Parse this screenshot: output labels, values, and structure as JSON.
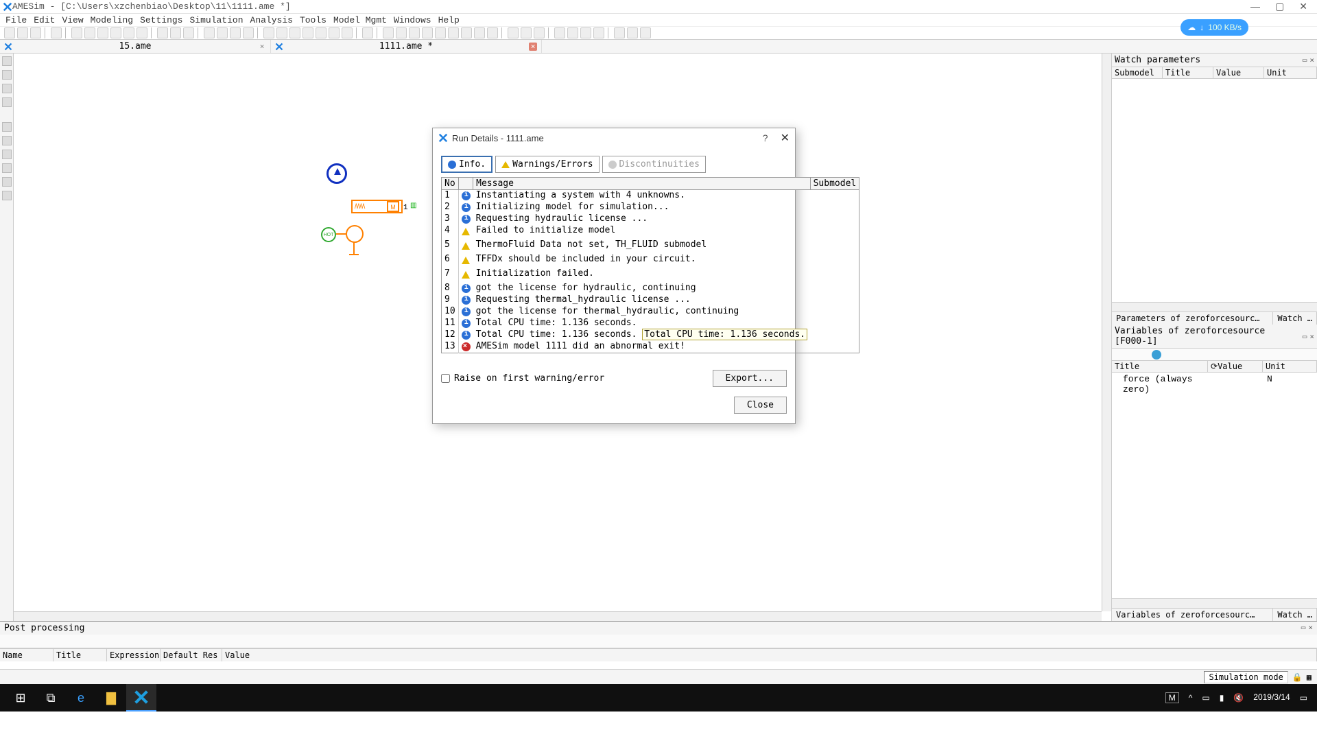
{
  "titlebar": {
    "text": "AMESim - [C:\\Users\\xzchenbiao\\Desktop\\11\\1111.ame *]"
  },
  "menu": [
    "File",
    "Edit",
    "View",
    "Modeling",
    "Settings",
    "Simulation",
    "Analysis",
    "Tools",
    "Model Mgmt",
    "Windows",
    "Help"
  ],
  "speed": {
    "value": "100 KB/s"
  },
  "doctabs": [
    {
      "label": "15.ame",
      "active": false
    },
    {
      "label": "1111.ame *",
      "active": true
    }
  ],
  "canvas": {
    "label1": "1",
    "hot": "HOT",
    "massM": "M"
  },
  "dialog": {
    "title": "Run Details - 1111.ame",
    "tab_info": "Info.",
    "tab_warn": "Warnings/Errors",
    "tab_disc": "Discontinuities",
    "col_no": "No",
    "col_msg": "Message",
    "col_sub": "Submodel",
    "rows": [
      {
        "no": "1",
        "type": "info",
        "msg": "Instantiating a system with 4 unknowns."
      },
      {
        "no": "2",
        "type": "info",
        "msg": "Initializing model for simulation..."
      },
      {
        "no": "3",
        "type": "info",
        "msg": "Requesting hydraulic license ..."
      },
      {
        "no": "4",
        "type": "warn",
        "msg": "Failed to initialize model"
      },
      {
        "no": "5",
        "type": "warn",
        "msg": "ThermoFluid Data not set, TH_FLUID submodel"
      },
      {
        "no": "6",
        "type": "warn",
        "msg": "TFFDx should be included in your circuit."
      },
      {
        "no": "7",
        "type": "warn",
        "msg": "Initialization failed."
      },
      {
        "no": "8",
        "type": "info",
        "msg": "got the license for hydraulic, continuing"
      },
      {
        "no": "9",
        "type": "info",
        "msg": "Requesting thermal_hydraulic license ..."
      },
      {
        "no": "10",
        "type": "info",
        "msg": "got the license for thermal_hydraulic, continuing"
      },
      {
        "no": "11",
        "type": "info",
        "msg": "Total CPU time: 1.136 seconds."
      },
      {
        "no": "12",
        "type": "info",
        "msg": "Total CPU time: 1.136 seconds.",
        "highlight": "Total CPU time: 1.136 seconds."
      },
      {
        "no": "13",
        "type": "err",
        "msg": "AMESim model 1111 did an abnormal exit!"
      }
    ],
    "check_label": "Raise on first warning/error",
    "btn_export": "Export...",
    "btn_close": "Close"
  },
  "watch": {
    "title": "Watch parameters",
    "cols": [
      "Submodel",
      "Title",
      "Value",
      "Unit"
    ],
    "tab_params": "Parameters of zeroforcesourc…",
    "tab_watch": "Watch …"
  },
  "vars": {
    "title": "Variables of zeroforcesource [F000-1]",
    "cols": [
      "Title",
      "Value",
      "Unit"
    ],
    "row": {
      "title": "force (always zero)",
      "value": "",
      "unit": "N"
    },
    "tab_vars": "Variables of zeroforcesourc…",
    "tab_watch": "Watch …"
  },
  "post": {
    "title": "Post processing",
    "cols": [
      "Name",
      "Title",
      "Expression",
      "Default Res",
      "Value"
    ]
  },
  "status": {
    "mode": "Simulation mode"
  },
  "taskbar": {
    "time": "",
    "date": "2019/3/14",
    "ime": "M"
  },
  "watermark": ""
}
